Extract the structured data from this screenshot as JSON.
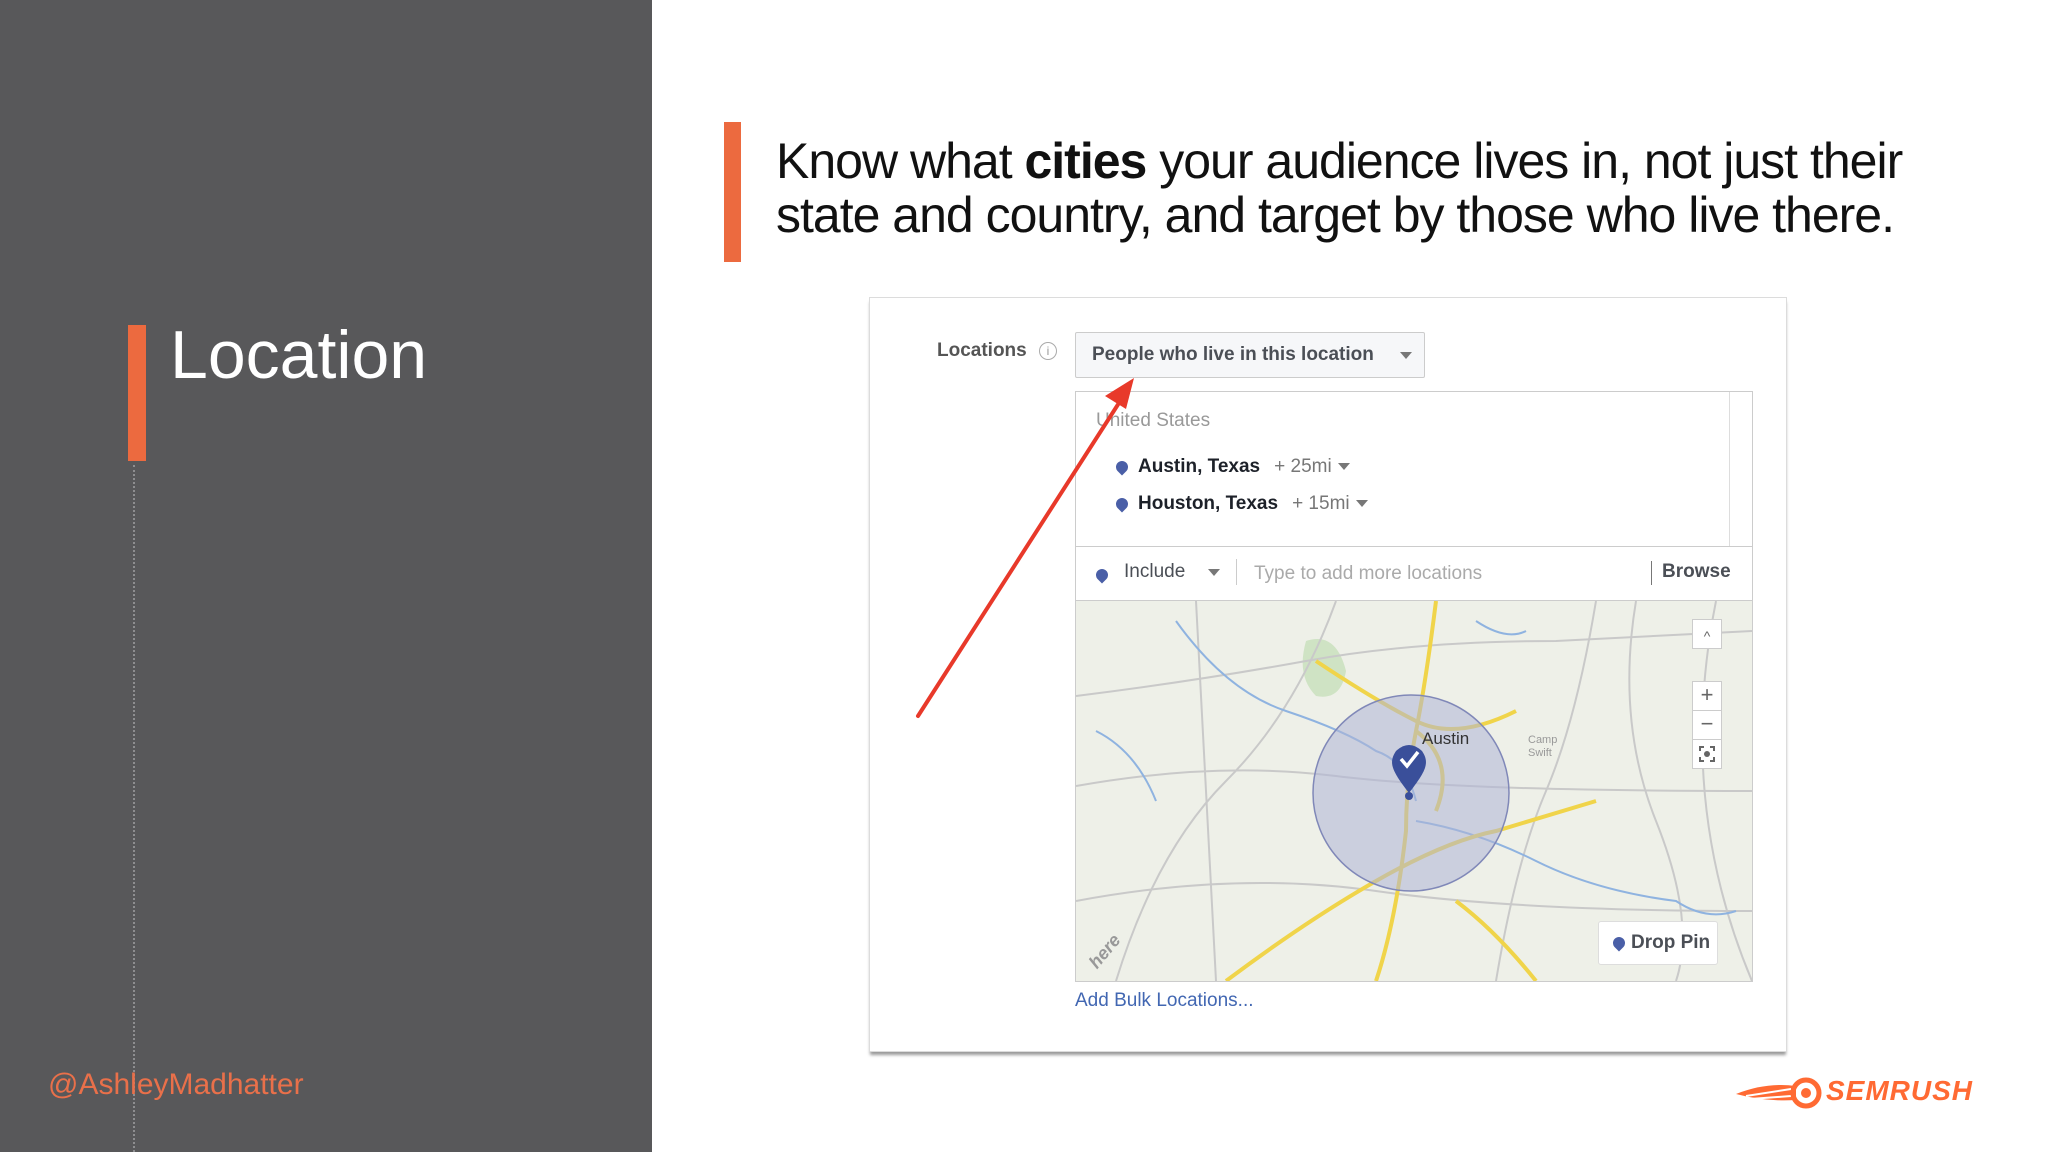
{
  "slide": {
    "section_title": "Location",
    "handle": "@AshleyMadhatter",
    "headline_pre": "Know what ",
    "headline_bold": "cities",
    "headline_post": " your audience lives in, not just their state and country, and target by those who live there.",
    "accent_color": "#ec6a3f",
    "left_panel_color": "#58585a"
  },
  "screenshot": {
    "locations_label": "Locations",
    "info_icon": "info-icon",
    "audience_dropdown": "People who live in this location",
    "country": "United States",
    "locations": [
      {
        "name": "Austin, Texas",
        "radius": "+ 25mi"
      },
      {
        "name": "Houston, Texas",
        "radius": "+ 15mi"
      }
    ],
    "include_label": "Include",
    "search_placeholder": "Type to add more locations",
    "browse_label": "Browse",
    "map": {
      "city_label": "Austin",
      "nearby_label": "Camp Swift",
      "watermark": "here",
      "zoom_in": "+",
      "zoom_out": "−",
      "collapse": "^",
      "drop_pin_label": "Drop Pin"
    },
    "bulk_link": "Add Bulk Locations..."
  },
  "logo": {
    "text": "SEMRUSH",
    "color": "#ff6a33"
  }
}
